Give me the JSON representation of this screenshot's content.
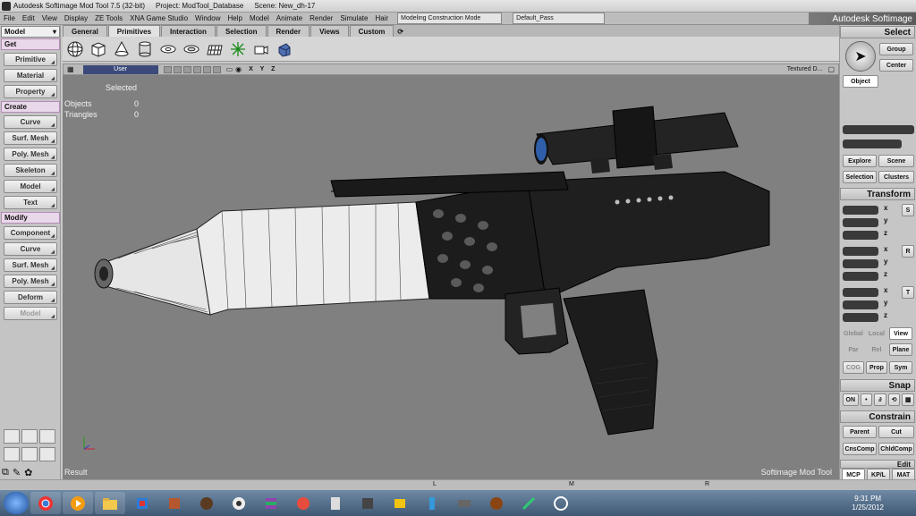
{
  "titlebar": {
    "app": "Autodesk Softimage Mod Tool 7.5 (32-bit)",
    "project": "Project: ModTool_Database",
    "scene": "Scene: New_dh-17"
  },
  "menu": {
    "items": [
      "File",
      "Edit",
      "View",
      "Display",
      "ZE Tools",
      "XNA Game Studio",
      "Window",
      "Help",
      "Model",
      "Animate",
      "Render",
      "Simulate",
      "Hair"
    ],
    "mode": "Modeling Construction Mode",
    "pass": "Default_Pass",
    "brand": "Autodesk Softimage"
  },
  "left": {
    "model_label": "Model",
    "get_label": "Get",
    "get_items": [
      "Primitive",
      "Material",
      "Property"
    ],
    "create_label": "Create",
    "create_items": [
      "Curve",
      "Surf. Mesh",
      "Poly. Mesh",
      "Skeleton",
      "Model",
      "Text"
    ],
    "modify_label": "Modify",
    "modify_items": [
      "Component",
      "Curve",
      "Surf. Mesh",
      "Poly. Mesh",
      "Deform",
      "Model"
    ]
  },
  "tabs": [
    "General",
    "Primitives",
    "Interaction",
    "Selection",
    "Render",
    "Views",
    "Custom"
  ],
  "viewport": {
    "camera": "User",
    "axes": "X Y Z",
    "display_mode": "Textured D...",
    "hud_header": "Selected",
    "hud_rows": [
      {
        "label": "Objects",
        "value": "0"
      },
      {
        "label": "Triangles",
        "value": "0"
      }
    ],
    "footer_left": "Result",
    "footer_right": "Softimage Mod Tool"
  },
  "right": {
    "select_label": "Select",
    "group": "Group",
    "center": "Center",
    "object": "Object",
    "explore": "Explore",
    "scene": "Scene",
    "selection": "Selection",
    "clusters": "Clusters",
    "transform_label": "Transform",
    "axis_labels": [
      "x",
      "y",
      "z"
    ],
    "transform_side": [
      "S",
      "R",
      "T"
    ],
    "global": "Global",
    "local": "Local",
    "view": "View",
    "par": "Par",
    "rel": "Rel",
    "plane": "Plane",
    "cog": "COG",
    "prop": "Prop",
    "sym": "Sym",
    "snap_label": "Snap",
    "on": "ON",
    "constrain_label": "Constrain",
    "parent": "Parent",
    "cut": "Cut",
    "cnscomp": "CnsComp",
    "childcomp": "ChldComp",
    "edit_label": "Edit",
    "mcp": "MCP",
    "kpl": "KP/L",
    "mat": "MAT"
  },
  "status": {
    "markers": [
      "L",
      "M",
      "R"
    ]
  },
  "taskbar": {
    "time": "9:31 PM",
    "date": "1/25/2012"
  }
}
